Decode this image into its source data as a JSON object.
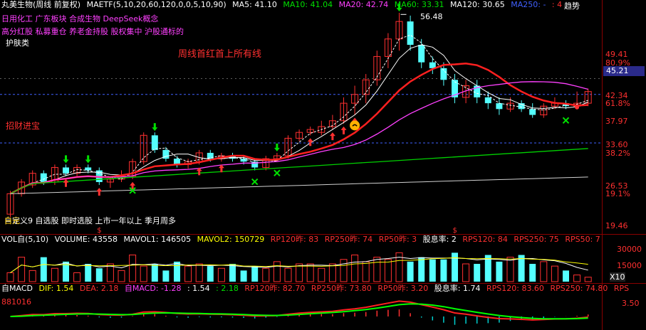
{
  "header": {
    "stock": "丸美生物(周线 前复权)",
    "indicator": "MAETF(5,10,20,60,120,0,0,5,10,90)",
    "ma5": "MA5: 41.10",
    "ma10": "MA10: 41.04",
    "ma20": "MA20: 42.74",
    "ma60": "MA60: 33.31",
    "ma120": "MA120: 30.65",
    "ma250": "MA250: -",
    "ma_last": ": 41.04",
    "trend_button": "趋势"
  },
  "concepts": {
    "line1": "日用化工 广东板块 合成生物 DeepSeek概念",
    "line2": "高分红股 私募重仓 养老金持股 股权集中 沪股通标的",
    "line3": "护肤类"
  },
  "annotations": {
    "weekly_red": "周线首红首上所有线",
    "zhaocai": "招财进宝",
    "peak_price": "56.48",
    "bottom_text": "自定义9 自选股 即时选股 上市一年以上 季月周多",
    "bottom_marker": "白元"
  },
  "price_axis": {
    "ticks": [
      "49.41",
      "80.9%",
      "45.21",
      "42.34",
      "61.8%",
      "37.97",
      "33.60",
      "38.2%",
      "26.53",
      "19.1%",
      "19.46"
    ],
    "current": "45.21"
  },
  "volume": {
    "header": [
      "VOL自(5,10)",
      "VOLUME: 43558",
      "MAVOL1: 146505",
      "MAVOL2: 150729",
      "RP120昨: 83",
      "RP250昨: 74",
      "RP50昨: 3",
      "股息率: 2",
      "RPS120: 84",
      "RPS250: 75",
      "RPS50: 7"
    ],
    "axis": [
      "30000",
      "15000",
      "X10"
    ],
    "values": [
      4,
      11,
      5,
      11,
      6,
      9,
      4,
      8,
      6,
      8,
      5,
      12,
      7,
      8,
      5,
      9,
      7,
      8,
      7,
      6,
      8,
      5,
      7,
      6,
      9,
      6,
      8,
      8,
      6,
      8,
      10,
      12,
      9,
      11,
      10,
      13,
      9,
      11,
      10,
      10,
      13,
      8,
      8,
      12,
      9,
      11,
      12,
      8,
      9,
      7,
      5,
      3,
      2
    ]
  },
  "macd": {
    "header": [
      "自MACD",
      "DIF: 1.54",
      "DEA: 2.18",
      "自MACD: -1.28",
      ": 1.54",
      ": 2.18",
      "RP120昨: 82.70",
      "RP250昨: 73.80",
      "RP50昨: 3.20",
      "股息率: 1.74",
      "RPS120: 83.60",
      "RPS250: 74.80",
      "RPS"
    ],
    "code": "881016",
    "axis": "3.50"
  },
  "colors": {
    "up": "#ff3030",
    "down": "#54ffff",
    "ma5": "#ffffff",
    "ma10": "#ffff00",
    "ma20": "#ff2020",
    "ma60": "#ff40ff",
    "ma120": "#00c000",
    "axis": "#8b0000"
  },
  "chart_data": {
    "type": "candlestick",
    "candles": [
      [
        22.0,
        25.5,
        21.5,
        26.0
      ],
      [
        25.5,
        27.5,
        25.0,
        28.0
      ],
      [
        27.0,
        29.0,
        26.5,
        29.5
      ],
      [
        29.0,
        27.5,
        27.0,
        29.5
      ],
      [
        27.5,
        30.0,
        27.0,
        30.5
      ],
      [
        30.0,
        29.0,
        28.5,
        30.5
      ],
      [
        29.0,
        30.0,
        28.5,
        30.5
      ],
      [
        30.0,
        29.5,
        29.0,
        30.5
      ],
      [
        29.5,
        27.5,
        27.0,
        30.0
      ],
      [
        27.5,
        28.0,
        26.5,
        28.5
      ],
      [
        28.0,
        28.5,
        27.5,
        29.5
      ],
      [
        28.5,
        31.0,
        28.0,
        31.5
      ],
      [
        31.0,
        35.5,
        30.5,
        36.0
      ],
      [
        35.5,
        33.0,
        32.5,
        36.0
      ],
      [
        33.0,
        31.5,
        31.0,
        33.5
      ],
      [
        31.5,
        30.5,
        30.0,
        32.0
      ],
      [
        30.5,
        31.0,
        29.8,
        31.5
      ],
      [
        31.0,
        32.5,
        30.5,
        33.0
      ],
      [
        32.5,
        31.5,
        31.0,
        33.0
      ],
      [
        31.5,
        32.0,
        31.0,
        32.5
      ],
      [
        32.0,
        31.5,
        31.0,
        32.5
      ],
      [
        31.5,
        31.0,
        30.5,
        32.0
      ],
      [
        31.0,
        30.0,
        29.5,
        31.5
      ],
      [
        30.0,
        31.5,
        29.5,
        32.0
      ],
      [
        31.5,
        32.0,
        31.0,
        32.5
      ],
      [
        32.0,
        35.0,
        31.5,
        35.5
      ],
      [
        35.0,
        36.0,
        34.5,
        36.5
      ],
      [
        36.0,
        36.5,
        35.5,
        37.0
      ],
      [
        36.0,
        37.0,
        35.5,
        38.0
      ],
      [
        37.0,
        38.0,
        36.5,
        39.0
      ],
      [
        38.0,
        41.0,
        37.5,
        42.0
      ],
      [
        41.0,
        42.5,
        39.0,
        44.0
      ],
      [
        42.5,
        45.0,
        41.0,
        46.0
      ],
      [
        45.0,
        49.0,
        44.0,
        50.0
      ],
      [
        49.0,
        52.0,
        47.0,
        53.0
      ],
      [
        52.0,
        55.0,
        50.0,
        56.48
      ],
      [
        55.0,
        51.0,
        50.0,
        56.0
      ],
      [
        51.0,
        48.0,
        47.0,
        52.0
      ],
      [
        48.0,
        47.0,
        46.0,
        49.0
      ],
      [
        47.0,
        45.0,
        44.0,
        48.0
      ],
      [
        45.0,
        42.0,
        41.0,
        46.0
      ],
      [
        42.0,
        44.0,
        41.0,
        45.0
      ],
      [
        44.0,
        42.0,
        41.0,
        45.0
      ],
      [
        42.0,
        41.0,
        40.0,
        43.0
      ],
      [
        41.0,
        40.0,
        39.0,
        42.0
      ],
      [
        40.0,
        41.0,
        39.5,
        42.0
      ],
      [
        41.0,
        40.0,
        39.5,
        41.5
      ],
      [
        40.0,
        39.0,
        38.5,
        41.0
      ],
      [
        39.0,
        40.5,
        38.5,
        41.0
      ],
      [
        40.5,
        41.0,
        40.0,
        42.0
      ],
      [
        41.0,
        40.5,
        40.0,
        41.5
      ],
      [
        40.5,
        41.0,
        40.0,
        43.0
      ],
      [
        41.0,
        43.0,
        40.5,
        43.5
      ]
    ],
    "ylim": [
      19.46,
      56.48
    ]
  }
}
